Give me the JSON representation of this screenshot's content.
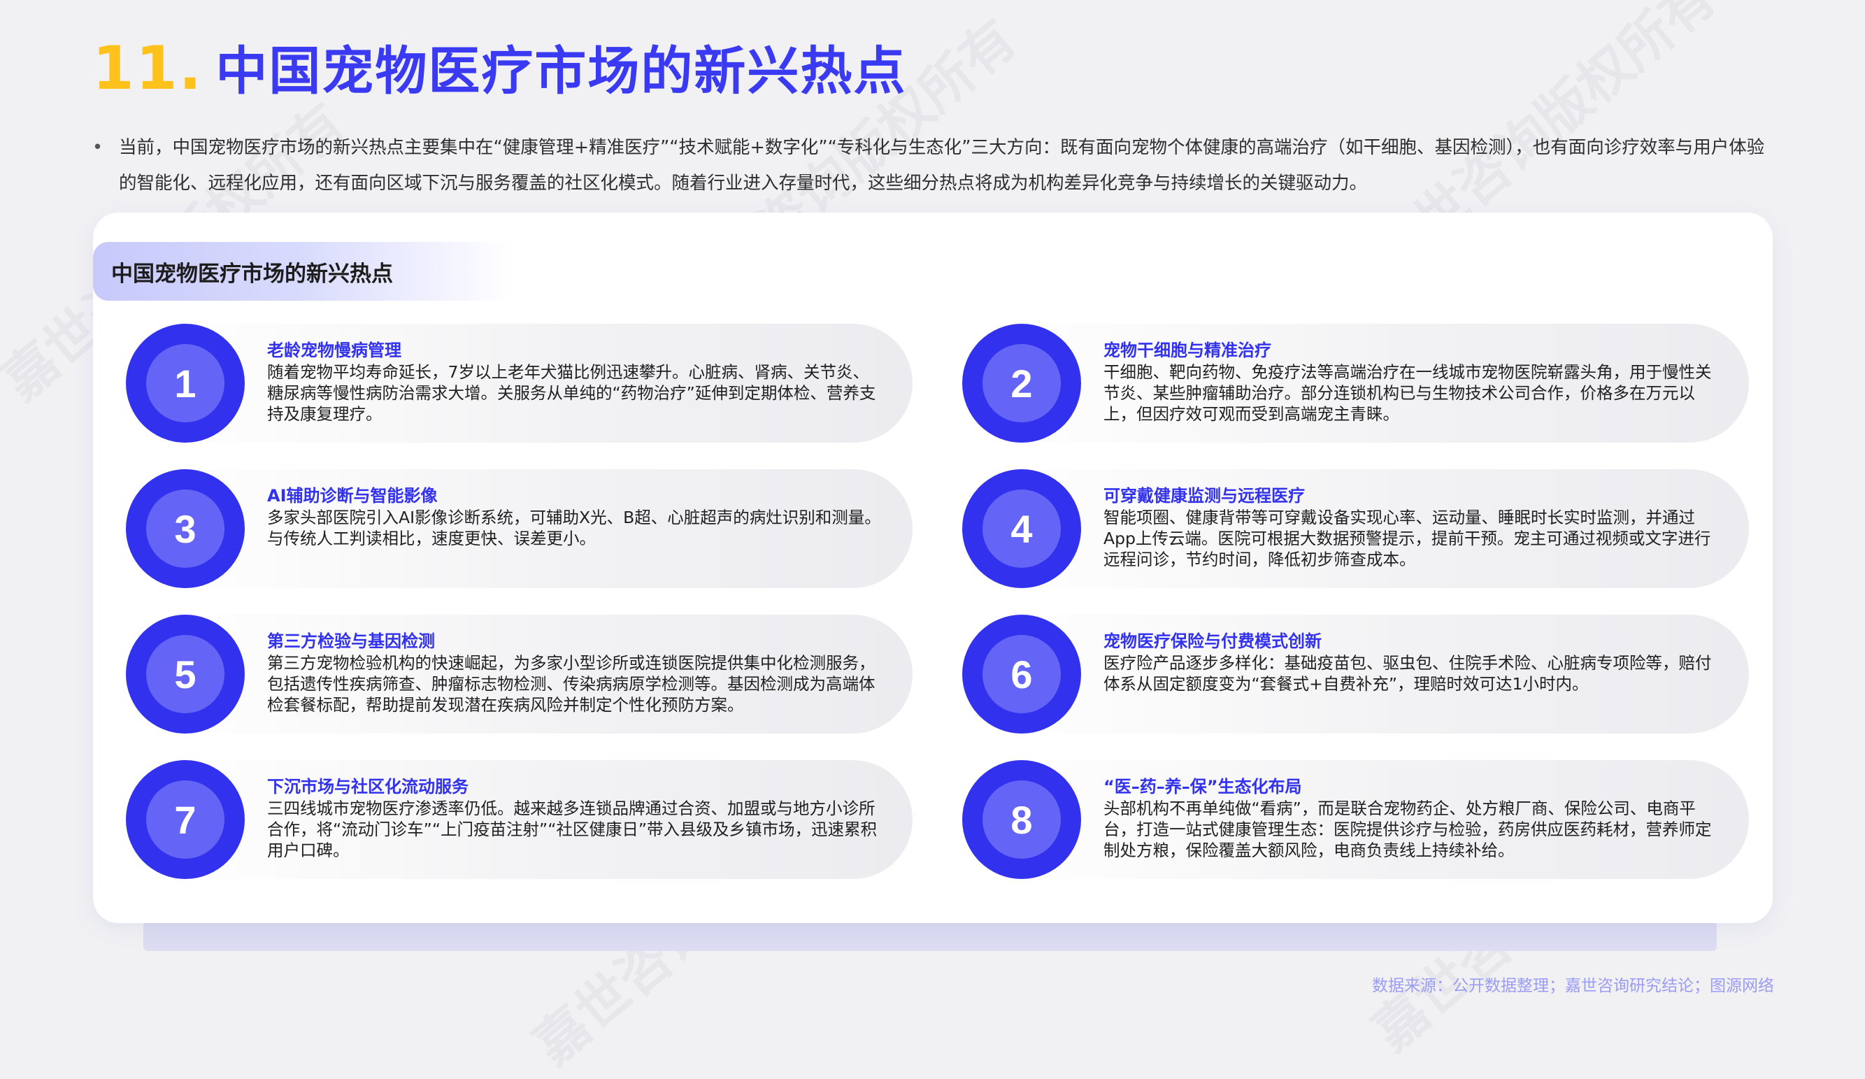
{
  "header": {
    "number": "11.",
    "title": "中国宠物医疗市场的新兴热点"
  },
  "intro": "当前，中国宠物医疗市场的新兴热点主要集中在“健康管理+精准医疗”“技术赋能+数字化”“专科化与生态化”三大方向：既有面向宠物个体健康的高端治疗（如干细胞、基因检测），也有面向诊疗效率与用户体验的智能化、远程化应用，还有面向区域下沉与服务覆盖的社区化模式。随着行业进入存量时代，这些细分热点将成为机构差异化竞争与持续增长的关键驱动力。",
  "panel": {
    "title": "中国宠物医疗市场的新兴热点",
    "items": [
      {
        "num": "1",
        "title": "老龄宠物慢病管理",
        "desc": "随着宠物平均寿命延长，7岁以上老年犬猫比例迅速攀升。心脏病、肾病、关节炎、糖尿病等慢性病防治需求大增。关服务从单纯的“药物治疗”延伸到定期体检、营养支持及康复理疗。"
      },
      {
        "num": "2",
        "title": "宠物干细胞与精准治疗",
        "desc": "干细胞、靶向药物、免疫疗法等高端治疗在一线城市宠物医院崭露头角，用于慢性关节炎、某些肿瘤辅助治疗。部分连锁机构已与生物技术公司合作，价格多在万元以上，但因疗效可观而受到高端宠主青睐。"
      },
      {
        "num": "3",
        "title": "AI辅助诊断与智能影像",
        "desc": "多家头部医院引入AI影像诊断系统，可辅助X光、B超、心脏超声的病灶识别和测量。与传统人工判读相比，速度更快、误差更小。"
      },
      {
        "num": "4",
        "title": "可穿戴健康监测与远程医疗",
        "desc": "智能项圈、健康背带等可穿戴设备实现心率、运动量、睡眠时长实时监测，并通过App上传云端。医院可根据大数据预警提示，提前干预。宠主可通过视频或文字进行远程问诊，节约时间，降低初步筛查成本。"
      },
      {
        "num": "5",
        "title": "第三方检验与基因检测",
        "desc": "第三方宠物检验机构的快速崛起，为多家小型诊所或连锁医院提供集中化检测服务，包括遗传性疾病筛查、肿瘤标志物检测、传染病病原学检测等。基因检测成为高端体检套餐标配，帮助提前发现潜在疾病风险并制定个性化预防方案。"
      },
      {
        "num": "6",
        "title": "宠物医疗保险与付费模式创新",
        "desc": "医疗险产品逐步多样化：基础疫苗包、驱虫包、住院手术险、心脏病专项险等，赔付体系从固定额度变为“套餐式+自费补充”，理赔时效可达1小时内。"
      },
      {
        "num": "7",
        "title": "下沉市场与社区化流动服务",
        "desc": "三四线城市宠物医疗渗透率仍低。越来越多连锁品牌通过合资、加盟或与地方小诊所合作，将“流动门诊车”“上门疫苗注射”“社区健康日”带入县级及乡镇市场，迅速累积用户口碑。"
      },
      {
        "num": "8",
        "title": "“医–药–养–保”生态化布局",
        "desc": "头部机构不再单纯做“看病”，而是联合宠物药企、处方粮厂商、保险公司、电商平台，打造一站式健康管理生态：医院提供诊疗与检验，药房供应医药耗材，营养师定制处方粮，保险覆盖大额风险，电商负责线上持续补给。"
      }
    ]
  },
  "source": "数据来源：公开数据整理；嘉世咨询研究结论；图源网络",
  "watermark": "嘉世咨询版权所有",
  "colors": {
    "accent_blue": "#3232ee",
    "accent_yellow": "#ffc21c",
    "source_text": "#9b9cf4"
  }
}
